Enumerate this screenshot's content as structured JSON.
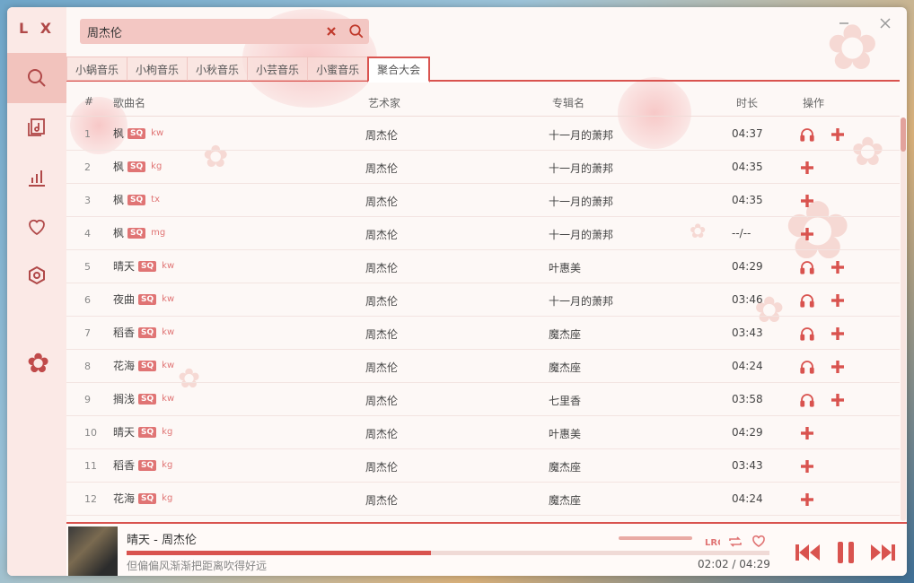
{
  "app": {
    "logo": "L X"
  },
  "colors": {
    "accent": "#d9534f",
    "sidebar": "#fbe9e6",
    "active_nav": "#f2c3bd"
  },
  "sidebar": {
    "items": [
      {
        "icon": "search-icon",
        "active": true
      },
      {
        "icon": "music-list-icon",
        "active": false
      },
      {
        "icon": "chart-icon",
        "active": false
      },
      {
        "icon": "heart-icon",
        "active": false
      },
      {
        "icon": "settings-icon",
        "active": false
      }
    ]
  },
  "search": {
    "value": "周杰伦"
  },
  "tabs": [
    {
      "label": "小蜗音乐",
      "active": false
    },
    {
      "label": "小枸音乐",
      "active": false
    },
    {
      "label": "小秋音乐",
      "active": false
    },
    {
      "label": "小芸音乐",
      "active": false
    },
    {
      "label": "小蜜音乐",
      "active": false
    },
    {
      "label": "聚合大会",
      "active": true
    }
  ],
  "table": {
    "headers": {
      "index": "#",
      "name": "歌曲名",
      "artist": "艺术家",
      "album": "专辑名",
      "duration": "时长",
      "ops": "操作"
    },
    "rows": [
      {
        "num": "1",
        "name": "枫",
        "badge": "SQ",
        "src": "kw",
        "artist": "周杰伦",
        "album": "十一月的萧邦",
        "dur": "04:37",
        "listen": true
      },
      {
        "num": "2",
        "name": "枫",
        "badge": "SQ",
        "src": "kg",
        "artist": "周杰伦",
        "album": "十一月的萧邦",
        "dur": "04:35",
        "listen": false
      },
      {
        "num": "3",
        "name": "枫",
        "badge": "SQ",
        "src": "tx",
        "artist": "周杰伦",
        "album": "十一月的萧邦",
        "dur": "04:35",
        "listen": false
      },
      {
        "num": "4",
        "name": "枫",
        "badge": "SQ",
        "src": "mg",
        "artist": "周杰伦",
        "album": "十一月的萧邦",
        "dur": "--/--",
        "listen": false
      },
      {
        "num": "5",
        "name": "晴天",
        "badge": "SQ",
        "src": "kw",
        "artist": "周杰伦",
        "album": "叶惠美",
        "dur": "04:29",
        "listen": true
      },
      {
        "num": "6",
        "name": "夜曲",
        "badge": "SQ",
        "src": "kw",
        "artist": "周杰伦",
        "album": "十一月的萧邦",
        "dur": "03:46",
        "listen": true
      },
      {
        "num": "7",
        "name": "稻香",
        "badge": "SQ",
        "src": "kw",
        "artist": "周杰伦",
        "album": "魔杰座",
        "dur": "03:43",
        "listen": true
      },
      {
        "num": "8",
        "name": "花海",
        "badge": "SQ",
        "src": "kw",
        "artist": "周杰伦",
        "album": "魔杰座",
        "dur": "04:24",
        "listen": true
      },
      {
        "num": "9",
        "name": "搁浅",
        "badge": "SQ",
        "src": "kw",
        "artist": "周杰伦",
        "album": "七里香",
        "dur": "03:58",
        "listen": true
      },
      {
        "num": "10",
        "name": "晴天",
        "badge": "SQ",
        "src": "kg",
        "artist": "周杰伦",
        "album": "叶惠美",
        "dur": "04:29",
        "listen": false
      },
      {
        "num": "11",
        "name": "稻香",
        "badge": "SQ",
        "src": "kg",
        "artist": "周杰伦",
        "album": "魔杰座",
        "dur": "03:43",
        "listen": false
      },
      {
        "num": "12",
        "name": "花海",
        "badge": "SQ",
        "src": "kg",
        "artist": "周杰伦",
        "album": "魔杰座",
        "dur": "04:24",
        "listen": false
      }
    ]
  },
  "player": {
    "title": "晴天 - 周杰伦",
    "lyric": "但偏偏风渐渐把距离吹得好远",
    "current_time": "02:02",
    "separator": "/",
    "total_time": "04:29",
    "progress": 0.474,
    "volume": 1.0
  }
}
